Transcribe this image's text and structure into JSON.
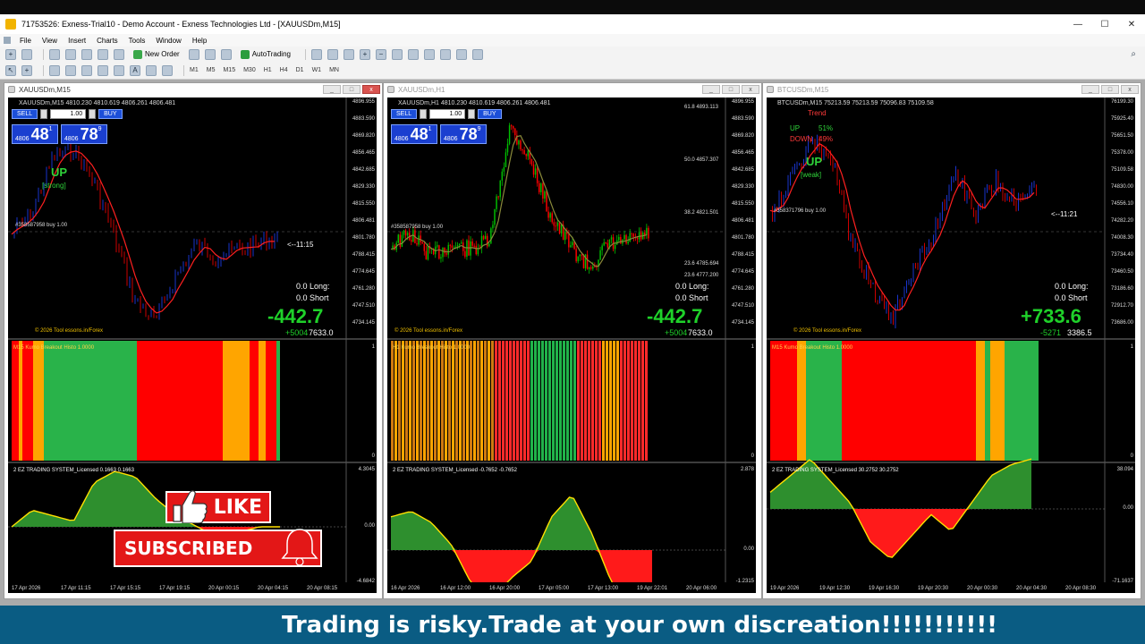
{
  "window": {
    "title": "71753526: Exness-Trial10 - Demo Account - Exness Technologies Ltd - [XAUUSDm,M15]",
    "controls": [
      "—",
      "☐",
      "✕"
    ]
  },
  "menu": [
    "File",
    "View",
    "Insert",
    "Charts",
    "Tools",
    "Window",
    "Help"
  ],
  "toolbar": {
    "new_order": "New Order",
    "autotrading": "AutoTrading"
  },
  "timeframes": [
    "M1",
    "M5",
    "M15",
    "M30",
    "H1",
    "H4",
    "D1",
    "W1",
    "MN"
  ],
  "charts": [
    {
      "title": "XAUUSDm,M15",
      "info": "XAUUSDm,M15 4810.230 4810.619 4806.261 4806.481",
      "sell": "SELL",
      "buy": "BUY",
      "lot": "1.00",
      "bid_prefix": "4806",
      "bid_big": "48",
      "bid_tiny": "1",
      "ask_prefix": "4806",
      "ask_big": "78",
      "ask_tiny": "9",
      "trend": "UP",
      "trend_note": "[strong]",
      "countdown": "<--11:15",
      "order_label": "#358587958 buy 1.00",
      "long": "0.0  Long:",
      "short": "0.0  Short",
      "pnl": "-442.7",
      "pnl_sub": "+5004",
      "pnl_val": "7633.0",
      "site": "© 2026 Tool essons.in/Forex",
      "price_axis": [
        "4896.955",
        "4883.590",
        "4869.820",
        "4856.465",
        "4842.685",
        "4829.330",
        "4815.550",
        "4806.481",
        "4801.780",
        "4788.415",
        "4774.645",
        "4761.280",
        "4747.510",
        "4734.145"
      ],
      "ind1_label": "M15 Kumo Breakout Histo 1.0000",
      "ind1_axis": [
        "1",
        "0"
      ],
      "ind2_label": "2 EZ TRADING SYSTEM_Licensed 0.1663 0.1663",
      "ind2_axis": [
        "4.3045",
        "0.00",
        "-4.6842"
      ],
      "time_axis": [
        "17 Apr 2026",
        "17 Apr 11:15",
        "17 Apr 15:15",
        "17 Apr 19:15",
        "20 Apr 00:15",
        "20 Apr 04:15",
        "20 Apr 08:15"
      ]
    },
    {
      "title": "XAUUSDm,H1",
      "info": "XAUUSDm,H1 4810.230 4810.619 4806.261 4806.481",
      "sell": "SELL",
      "buy": "BUY",
      "lot": "1.00",
      "bid_prefix": "4806",
      "bid_big": "48",
      "bid_tiny": "1",
      "ask_prefix": "4806",
      "ask_big": "78",
      "ask_tiny": "9",
      "fib1": "61.8  4893.113",
      "fib2": "50.0  4857.307",
      "fib3": "38.2  4821.501",
      "fib4": "23.6  4785.694",
      "fib5": "23.6  4777.200",
      "order_label": "#358587958 buy 1.00",
      "long": "0.0  Long:",
      "short": "0.0  Short",
      "pnl": "-442.7",
      "pnl_sub": "+5004",
      "pnl_val": "7633.0",
      "site": "© 2026 Tool essons.in/Forex",
      "price_axis": [
        "4896.955",
        "4883.590",
        "4869.820",
        "4856.465",
        "4842.685",
        "4829.330",
        "4815.550",
        "4806.481",
        "4801.780",
        "4788.415",
        "4774.645",
        "4761.280",
        "4747.510",
        "4734.145"
      ],
      "ind1_label": "H1 Kumo Breakout Histo 1.0000",
      "ind1_axis": [
        "1",
        "0"
      ],
      "ind2_label": "2 EZ TRADING SYSTEM_Licensed -0.7652 -0.7652",
      "ind2_axis": [
        "2.878",
        "0.00",
        "-1.2315"
      ],
      "time_axis": [
        "16 Apr 2026",
        "16 Apr 12:00",
        "16 Apr 20:00",
        "17 Apr 05:00",
        "17 Apr 13:00",
        "19 Apr 22:01",
        "20 Apr 06:00"
      ]
    },
    {
      "title": "BTCUSDm,M15",
      "info": "BTCUSDm,M15 75213.59 75213.59 75096.83 75109.58",
      "trend_header": "Trend",
      "up_label": "UP",
      "up_pct": "51%",
      "down_label": "DOWN",
      "down_pct": "49%",
      "trend": "UP",
      "trend_note": "[weak]",
      "countdown": "<--11:21",
      "order_label": "#358371796 buy 1.00",
      "long": "0.0  Long:",
      "short": "0.0  Short",
      "pnl": "+733.6",
      "pnl_sub": "-5271",
      "pnl_val": "3386.5",
      "site": "© 2026 Tool essons.in/Forex",
      "price_axis": [
        "76199.30",
        "75925.40",
        "75651.50",
        "75378.00",
        "75109.58",
        "74830.00",
        "74556.10",
        "74282.20",
        "74008.30",
        "73734.40",
        "73460.50",
        "73186.60",
        "72912.70",
        "73686.00"
      ],
      "ind1_label": "M15 Kumo Breakout Histo 1.0000",
      "ind1_axis": [
        "1",
        "0"
      ],
      "ind2_label": "2 EZ TRADING SYSTEM_Licensed 30.2752 30.2752",
      "ind2_axis": [
        "38.094",
        "0.00",
        "-71.1637"
      ],
      "time_axis": [
        "19 Apr 2026",
        "19 Apr 12:30",
        "19 Apr 16:30",
        "19 Apr 20:30",
        "20 Apr 00:30",
        "20 Apr 04:30",
        "20 Apr 08:30"
      ]
    }
  ],
  "overlay": {
    "like": "LIKE",
    "subscribed": "SUBSCRIBED"
  },
  "banner": "Trading is risky.Trade at your own discreation!!!!!!!!!!!",
  "colors": {
    "bull": "#00c000",
    "bear": "#ff0000",
    "accent_blue": "#1a3fd0",
    "banner_bg": "#0a5c83"
  }
}
